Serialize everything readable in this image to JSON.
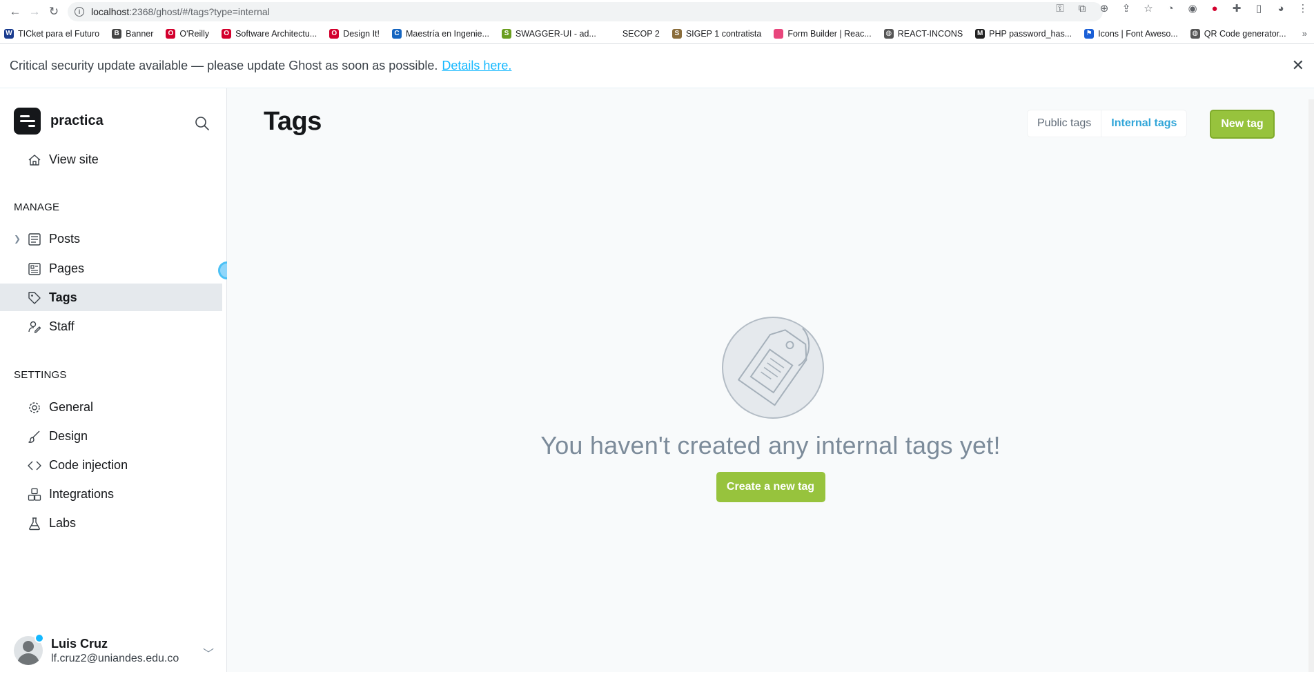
{
  "browser": {
    "url_host": "localhost",
    "url_path": ":2368/ghost/#/tags?type=internal",
    "bookmarks": [
      {
        "label": "TICket para el Futuro",
        "color": "#1a3c8f",
        "glyph": "W"
      },
      {
        "label": "Banner",
        "color": "#444444",
        "glyph": "B"
      },
      {
        "label": "O'Reilly",
        "color": "#d3002d",
        "glyph": "O"
      },
      {
        "label": "Software Architectu...",
        "color": "#d3002d",
        "glyph": "O"
      },
      {
        "label": "Design It!",
        "color": "#d3002d",
        "glyph": "O"
      },
      {
        "label": "Maestría en Ingenie...",
        "color": "#1565c0",
        "glyph": "C"
      },
      {
        "label": "SWAGGER-UI - ad...",
        "color": "#6a9e1f",
        "glyph": "S"
      },
      {
        "label": "SECOP 2",
        "color": "#ffffff",
        "glyph": ""
      },
      {
        "label": "SIGEP 1 contratista",
        "color": "#8a6d3b",
        "glyph": "S"
      },
      {
        "label": "Form Builder | Reac...",
        "color": "#e8467c",
        "glyph": ""
      },
      {
        "label": "REACT-INCONS",
        "color": "#555555",
        "glyph": "◍"
      },
      {
        "label": "PHP password_has...",
        "color": "#222222",
        "glyph": "M"
      },
      {
        "label": "Icons | Font Aweso...",
        "color": "#1a5fd6",
        "glyph": "⚑"
      },
      {
        "label": "QR Code generator...",
        "color": "#555555",
        "glyph": "◍"
      }
    ]
  },
  "banner": {
    "text": "Critical security update available — please update Ghost as soon as possible.",
    "link": "Details here."
  },
  "sidebar": {
    "site_name": "practica",
    "view_site": "View site",
    "manage_title": "MANAGE",
    "settings_title": "SETTINGS",
    "manage_items": [
      {
        "label": "Posts"
      },
      {
        "label": "Pages"
      },
      {
        "label": "Tags"
      },
      {
        "label": "Staff"
      }
    ],
    "settings_items": [
      {
        "label": "General"
      },
      {
        "label": "Design"
      },
      {
        "label": "Code injection"
      },
      {
        "label": "Integrations"
      },
      {
        "label": "Labs"
      }
    ],
    "user": {
      "name": "Luis Cruz",
      "email": "lf.cruz2@uniandes.edu.co"
    }
  },
  "main": {
    "title": "Tags",
    "tabs": [
      {
        "label": "Public tags"
      },
      {
        "label": "Internal tags"
      }
    ],
    "new_tag": "New tag",
    "empty_message": "You haven't created any internal tags yet!",
    "create_button": "Create a new tag"
  },
  "colors": {
    "accent_green": "#97c33d",
    "link_blue": "#14b8ff",
    "active_bg": "#e5e9ed"
  }
}
